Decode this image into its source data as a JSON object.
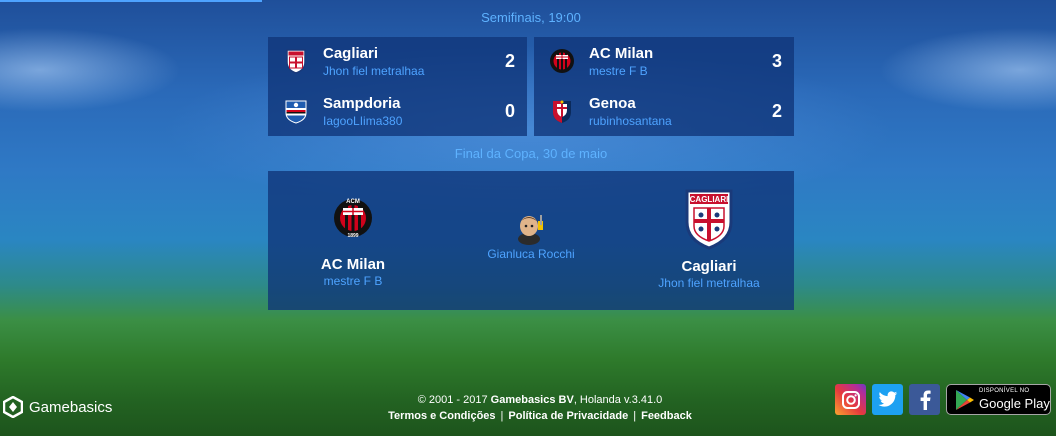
{
  "semifinals": {
    "title": "Semifinais,  19:00",
    "matches": [
      {
        "home": {
          "name": "Cagliari",
          "manager": "Jhon fiel metralhaa",
          "score": "2",
          "crest": "cagliari-crest-icon"
        },
        "away": {
          "name": "Sampdoria",
          "manager": "IagooLIima380",
          "score": "0",
          "crest": "sampdoria-crest-icon"
        }
      },
      {
        "home": {
          "name": "AC Milan",
          "manager": "mestre F B",
          "score": "3",
          "crest": "ac-milan-crest-icon"
        },
        "away": {
          "name": "Genoa",
          "manager": "rubinhosantana",
          "score": "2",
          "crest": "genoa-crest-icon"
        }
      }
    ]
  },
  "final": {
    "title": "Final da Copa,  30 de maio",
    "home": {
      "name": "AC Milan",
      "manager": "mestre F B",
      "crest": "ac-milan-crest-icon",
      "crest_text_top": "ACM",
      "crest_text_bottom": "1899"
    },
    "away": {
      "name": "Cagliari",
      "manager": "Jhon fiel metralhaa",
      "crest": "cagliari-crest-icon",
      "crest_text": "CAGLIARI"
    },
    "referee": {
      "name": "Gianluca Rocchi",
      "icon": "referee-icon"
    }
  },
  "footer": {
    "copyright_prefix": "© 2001 - 2017 ",
    "company": "Gamebasics BV",
    "copyright_suffix": ", Holanda v.3.41.0",
    "links": [
      "Termos e Condições",
      "Política de Privacidade",
      "Feedback"
    ],
    "separator": "|",
    "brand": "Gamebasics",
    "google_play_small": "DISPONÍVEL NO",
    "google_play_big": "Google Play"
  },
  "colors": {
    "accent_blue": "#4ea3ff",
    "card_bg": "#103478",
    "milan_red": "#d0021b",
    "cagliari_red": "#c8102e",
    "cagliari_blue": "#1a3a7a",
    "genoa_red": "#c8102e",
    "genoa_blue": "#0b2a5b"
  }
}
